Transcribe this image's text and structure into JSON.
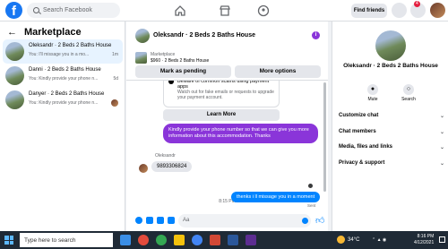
{
  "topbar": {
    "logo": "f",
    "search_placeholder": "Search Facebook",
    "find_friends": "Find friends",
    "notification_count": "4"
  },
  "marketplace": {
    "title": "Marketplace",
    "conversations": [
      {
        "title": "Oleksandr · 2 Beds 2 Baths House",
        "preview": "You: I'll missage you in a mo...",
        "time": "1m"
      },
      {
        "title": "Danni · 2 Beds 2 Baths House",
        "preview": "You: Kindly provide your phone n...",
        "time": "5d"
      },
      {
        "title": "Danyer · 2 Beds 2 Baths House",
        "preview": "You: Kindly provide your phone n...",
        "time": "1w"
      }
    ]
  },
  "chat": {
    "title": "Oleksandr · 2 Beds 2 Baths House",
    "listing_label": "Marketplace",
    "listing_text": "$960 · 2 Beds 2 Baths House",
    "pending_button": "Mark as pending",
    "more_options_button": "More options",
    "notice_title": "Beware of common scams using payment apps",
    "notice_body": "Watch out for fake emails or requests to upgrade your payment account.",
    "learn_more": "Learn More",
    "outgoing_message_1": "Kindly provide your phone number so that we can give you more information about this accommodation. Thanks",
    "sender_name": "Oleksandr",
    "incoming_message": "9893306824",
    "time_divider": "8:15 PM",
    "outgoing_message_2": "thenks i ll missage you in a moment",
    "sent_label": "Sent",
    "input_placeholder": "Aa"
  },
  "details": {
    "name": "Oleksandr · 2 Beds 2 Baths House",
    "actions": [
      {
        "icon": "bell-icon",
        "label": "Mute"
      },
      {
        "icon": "search-icon",
        "label": "Search"
      }
    ],
    "sections": [
      "Customize chat",
      "Chat members",
      "Media, files and links",
      "Privacy & support"
    ]
  },
  "taskbar": {
    "search_placeholder": "Type here to search",
    "temperature": "34°C",
    "time": "8:16 PM",
    "date": "4/12/2021"
  },
  "colors": {
    "accent_purple": "#8a35d9",
    "messenger_blue": "#0084ff",
    "facebook_blue": "#1877f2"
  }
}
